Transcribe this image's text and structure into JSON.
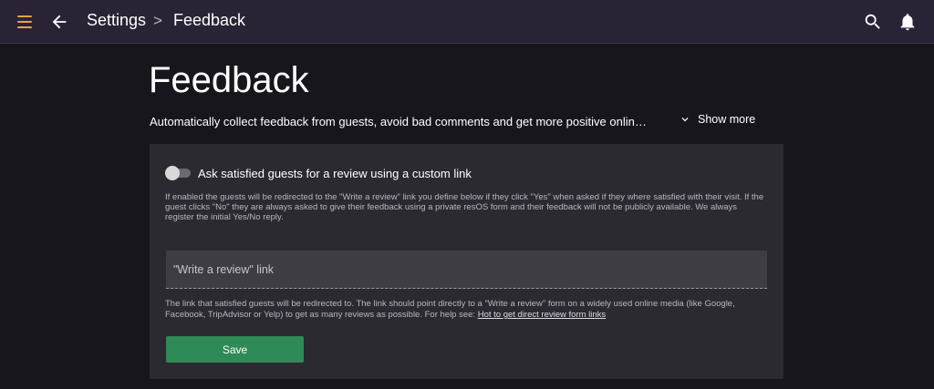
{
  "header": {
    "breadcrumb_parent": "Settings",
    "breadcrumb_separator": ">",
    "breadcrumb_current": "Feedback",
    "icons": [
      "menu-icon",
      "back-arrow-icon",
      "search-icon",
      "bell-icon"
    ],
    "accent_color": "#e0a542",
    "bar_color": "#2a2336"
  },
  "page": {
    "title": "Feedback",
    "description": "Automatically collect feedback from guests, avoid bad comments and get more positive onlin…",
    "show_more_label": "Show more"
  },
  "card": {
    "toggle_label": "Ask satisfied guests for a review using a custom link",
    "toggle_on": false,
    "help_text": "If enabled the guests will be redirected to the \"Write a review\" link you define below if they click \"Yes\" when asked if they where satisfied with their visit. If the guest clicks \"No\" they are always asked to give their feedback using a private resOS form and their feedback will not be publicly available. We always register the initial Yes/No reply.",
    "link_field_placeholder": "\"Write a review\" link",
    "link_help_text": "The link that satisfied guests will be redirected to. The link should point directly to a \"Write a review\" form on a widely used online media (like Google, Facebook, TripAdvisor or Yelp) to get as many reviews as possible. For help see: ",
    "link_help_anchor": "Hot to get direct review form links",
    "save_label": "Save",
    "save_color": "#2e8a56"
  }
}
